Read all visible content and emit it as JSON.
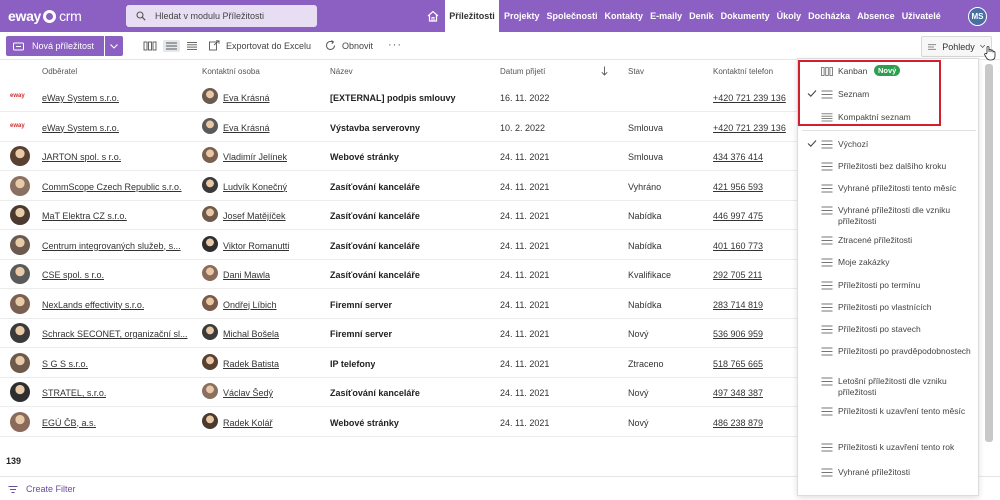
{
  "app": {
    "logo": "eway",
    "logo_suffix": "crm",
    "search_placeholder": "Hledat v modulu Příležitosti",
    "active_module": "Příležitosti",
    "nav": [
      "Projekty",
      "Společnosti",
      "Kontakty",
      "E-maily",
      "Deník",
      "Dokumenty",
      "Úkoly",
      "Docházka",
      "Absence",
      "Uživatelé"
    ],
    "user_initials": "MS",
    "brand_color": "#8c5fc3"
  },
  "toolbar": {
    "new_label": "Nová příležitost",
    "export_label": "Exportovat do Excelu",
    "refresh_label": "Obnovit",
    "more_label": "···",
    "views_label": "Pohledy"
  },
  "table": {
    "columns": [
      "Odběratel",
      "Kontaktní osoba",
      "Název",
      "Datum přijetí",
      "Stav",
      "Kontaktní telefon"
    ],
    "rows": [
      {
        "company": "eWay System s.r.o.",
        "contact": "Eva Krásná",
        "title": "[EXTERNAL] podpis smlouvy",
        "date": "16. 11. 2022",
        "status": "",
        "phone": "+420 721 239 136",
        "logo": "eway"
      },
      {
        "company": "eWay System s.r.o.",
        "contact": "Eva Krásná",
        "title": "Výstavba serverovny",
        "date": "10. 2. 2022",
        "status": "Smlouva",
        "phone": "+420 721 239 136",
        "logo": "eway"
      },
      {
        "company": "JARTON spol. s r.o.",
        "contact": "Vladimír Jelínek",
        "title": "Webové stránky",
        "date": "24. 11. 2021",
        "status": "Smlouva",
        "phone": "434 376 414",
        "logo": "person"
      },
      {
        "company": "CommScope Czech Republic s.r.o.",
        "contact": "Ludvík Konečný",
        "title": "Zasíťování kanceláře",
        "date": "24. 11. 2021",
        "status": "Vyhráno",
        "phone": "421 956 593",
        "logo": "person"
      },
      {
        "company": "MaT Elektra CZ s.r.o.",
        "contact": "Josef Matějíček",
        "title": "Zasíťování kanceláře",
        "date": "24. 11. 2021",
        "status": "Nabídka",
        "phone": "446 997 475",
        "logo": "person"
      },
      {
        "company": "Centrum integrovaných služeb, s...",
        "contact": "Viktor Romanutti",
        "title": "Zasíťování kanceláře",
        "date": "24. 11. 2021",
        "status": "Nabídka",
        "phone": "401 160 773",
        "logo": "person"
      },
      {
        "company": "CSE spol. s r.o.",
        "contact": "Dani Mawla",
        "title": "Zasíťování kanceláře",
        "date": "24. 11. 2021",
        "status": "Kvalifikace",
        "phone": "292 705 211",
        "logo": "person"
      },
      {
        "company": "NexLands effectivity s.r.o.",
        "contact": "Ondřej Líbich",
        "title": "Firemní server",
        "date": "24. 11. 2021",
        "status": "Nabídka",
        "phone": "283 714 819",
        "logo": "person"
      },
      {
        "company": "Schrack SECONET, organizační sl...",
        "contact": "Michal Bošela",
        "title": "Firemní server",
        "date": "24. 11. 2021",
        "status": "Nový",
        "phone": "536 906 959",
        "logo": "person"
      },
      {
        "company": "S G S s.r.o.",
        "contact": "Radek Batista",
        "title": "IP telefony",
        "date": "24. 11. 2021",
        "status": "Ztraceno",
        "phone": "518 765 665",
        "logo": "person"
      },
      {
        "company": "STRATEL, s.r.o.",
        "contact": "Václav Šedý",
        "title": "Zasíťování kanceláře",
        "date": "24. 11. 2021",
        "status": "Nový",
        "phone": "497 348 387",
        "logo": "person"
      },
      {
        "company": "EGÚ ČB, a.s.",
        "contact": "Radek Kolář",
        "title": "Webové stránky",
        "date": "24. 11. 2021",
        "status": "Nový",
        "phone": "486 238 879",
        "logo": "person"
      }
    ],
    "total_count": "139"
  },
  "footer": {
    "create_filter": "Create Filter"
  },
  "views_dropdown": {
    "layout_options": [
      {
        "label": "Kanban",
        "icon": "kanban-icon",
        "badge": "Nový",
        "checked": false
      },
      {
        "label": "Seznam",
        "icon": "list-icon",
        "checked": true
      },
      {
        "label": "Kompaktní seznam",
        "icon": "compact-list-icon",
        "checked": false
      }
    ],
    "saved_views": [
      {
        "label": "Výchozí",
        "checked": true
      },
      {
        "label": "Příležitosti bez dalšího kroku",
        "checked": false
      },
      {
        "label": "Vyhrané příležitosti tento měsíc",
        "checked": false
      },
      {
        "label": "Vyhrané příležitosti dle vzniku příležitosti",
        "checked": false
      },
      {
        "label": "Ztracené příležitosti",
        "checked": false
      },
      {
        "label": "Moje zakázky",
        "checked": false
      },
      {
        "label": "Příležitosti po termínu",
        "checked": false
      },
      {
        "label": "Příležitosti po vlastnících",
        "checked": false
      },
      {
        "label": "Příležitosti po stavech",
        "checked": false
      },
      {
        "label": "Příležitosti po pravděpodobnostech",
        "checked": false
      },
      {
        "label": "Letošní příležitosti dle vzniku příležitosti",
        "checked": false
      },
      {
        "label": "Příležitosti k uzavření tento měsíc",
        "checked": false
      },
      {
        "label": "Příležitosti k uzavření tento rok",
        "checked": false
      },
      {
        "label": "Vyhrané příležitosti",
        "checked": false
      }
    ],
    "highlight_color": "#d0202f",
    "badge_color": "#2e9e4f"
  }
}
